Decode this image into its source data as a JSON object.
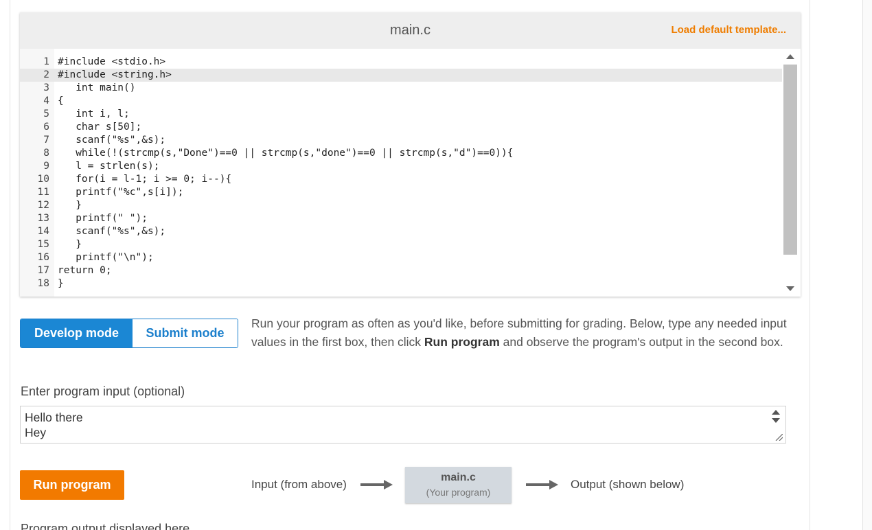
{
  "editor": {
    "file_name": "main.c",
    "load_template_label": "Load default template...",
    "lines": [
      {
        "no": "1",
        "text": "#include <stdio.h>"
      },
      {
        "no": "2",
        "text": "#include <string.h>"
      },
      {
        "no": "3",
        "text": "   int main()"
      },
      {
        "no": "4",
        "text": "{"
      },
      {
        "no": "5",
        "text": "   int i, l;"
      },
      {
        "no": "6",
        "text": "   char s[50];"
      },
      {
        "no": "7",
        "text": "   scanf(\"%s\",&s);"
      },
      {
        "no": "8",
        "text": "   while(!(strcmp(s,\"Done\")==0 || strcmp(s,\"done\")==0 || strcmp(s,\"d\")==0)){"
      },
      {
        "no": "9",
        "text": "   l = strlen(s);"
      },
      {
        "no": "10",
        "text": "   for(i = l-1; i >= 0; i--){"
      },
      {
        "no": "11",
        "text": "   printf(\"%c\",s[i]);"
      },
      {
        "no": "12",
        "text": "   }"
      },
      {
        "no": "13",
        "text": "   printf(\" \");"
      },
      {
        "no": "14",
        "text": "   scanf(\"%s\",&s);"
      },
      {
        "no": "15",
        "text": "   }"
      },
      {
        "no": "16",
        "text": "   printf(\"\\n\");"
      },
      {
        "no": "17",
        "text": "return 0;"
      },
      {
        "no": "18",
        "text": "}"
      }
    ]
  },
  "modes": {
    "develop_label": "Develop mode",
    "submit_label": "Submit mode",
    "active": "Develop mode"
  },
  "description": {
    "part1": "Run your program as often as you'd like, before submitting for grading. Below, type any needed input values in the first box, then click ",
    "bold": "Run program",
    "part2": " and observe the program's output in the second box."
  },
  "input": {
    "label": "Enter program input (optional)",
    "value": "Hello there\nHey\nd"
  },
  "run": {
    "button_label": "Run program"
  },
  "flow": {
    "input_label": "Input (from above)",
    "program_name": "main.c",
    "program_sub": "(Your program)",
    "output_label": "Output (shown below)"
  },
  "output": {
    "label": "Program output displayed here"
  },
  "colors": {
    "accent_blue": "#1b87d4",
    "accent_orange": "#f27a00",
    "template_link": "#ef7d00"
  }
}
